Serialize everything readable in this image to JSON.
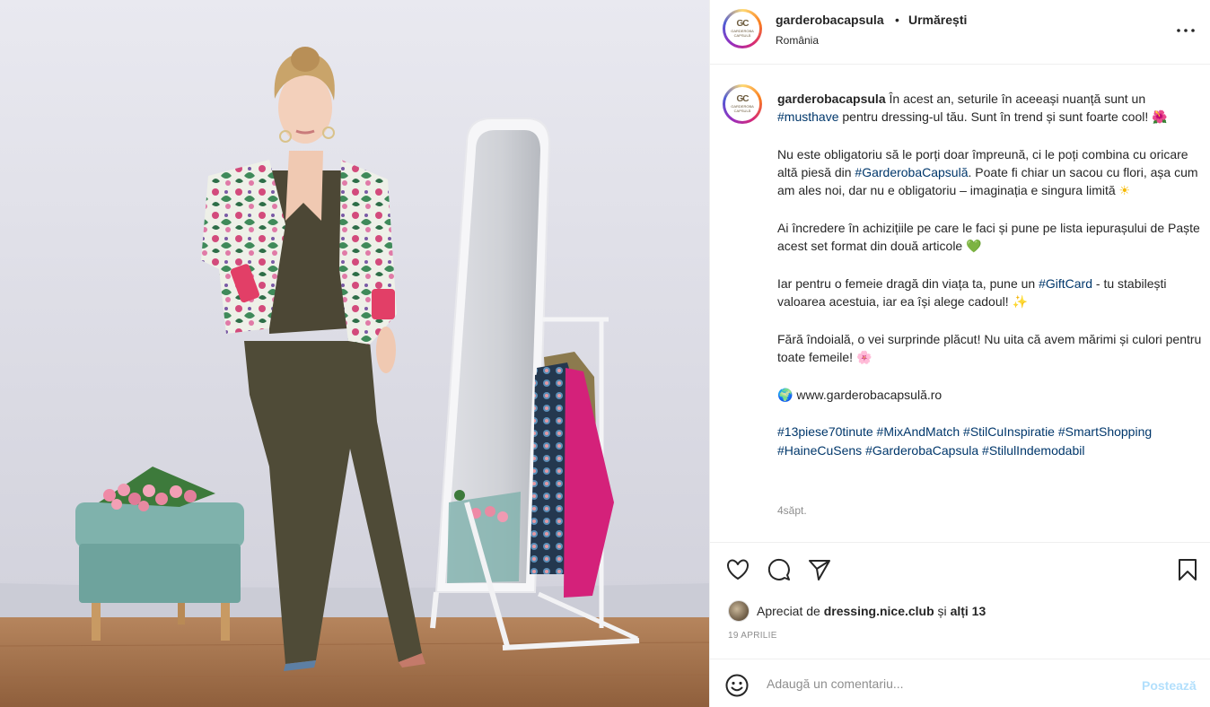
{
  "header": {
    "username": "garderobacapsula",
    "separator": "•",
    "follow_label": "Urmărești",
    "location": "România",
    "avatar_icon": "brand-logo-gc",
    "avatar_text": "GARDEROBA CAPSULĂ",
    "more_icon": "more-horizontal-icon"
  },
  "caption": {
    "username": "garderobacapsula",
    "p1_a": "În acest an, seturile în aceeași nuanță sunt un ",
    "p1_tag": "#musthave",
    "p1_b": " pentru dressing-ul tău. Sunt în trend și sunt foarte cool!",
    "p1_emoji": "🌺",
    "p2_a": "Nu este obligatoriu să le porți doar împreună, ci le poți combina cu oricare altă piesă din ",
    "p2_tag": "#GarderobaCapsulă",
    "p2_b": ". Poate fi chiar un sacou cu flori, așa cum am ales noi, dar nu e obligatoriu – imaginația e singura limită",
    "p2_emoji": "☀",
    "p3_a": "Ai încredere în achizițiile pe care le faci și pune pe lista iepurașului de Paște acest set format din două articole",
    "p3_emoji": "💚",
    "p4_a": "Iar pentru o femeie dragă din viața ta, pune un ",
    "p4_tag": "#GiftCard",
    "p4_b": " - tu stabilești valoarea acestuia, iar ea își alege cadoul!",
    "p4_emoji": "✨",
    "p5_a": "Fără îndoială, o vei surprinde plăcut! Nu uita că avem mărimi și culori pentru toate femeile!",
    "p5_emoji": "🌸",
    "p6_emoji": "🌍",
    "p6_a": "www.garderobacapsulă.ro",
    "hashtags": [
      "#13piese70tinute",
      "#MixAndMatch",
      "#StilCuInspiratie",
      "#SmartShopping",
      "#HaineCuSens",
      "#GarderobaCapsula",
      "#StilulIndemodabil"
    ],
    "time": "4săpt."
  },
  "actions": {
    "like_icon": "heart-icon",
    "comment_icon": "comment-icon",
    "share_icon": "send-icon",
    "save_icon": "bookmark-icon",
    "liked_by_prefix": "Apreciat de ",
    "liked_by_user": "dressing.nice.club",
    "liked_by_mid": " și ",
    "liked_by_others": "alți 13",
    "date": "19 APRILIE"
  },
  "comment_box": {
    "emoji_icon": "smiley-icon",
    "placeholder": "Adaugă un comentariu...",
    "post_label": "Postează",
    "post_color": "#b2dffc"
  },
  "colors": {
    "hashtag": "#00376b",
    "muted": "#8e8e8e",
    "text": "#262626"
  }
}
